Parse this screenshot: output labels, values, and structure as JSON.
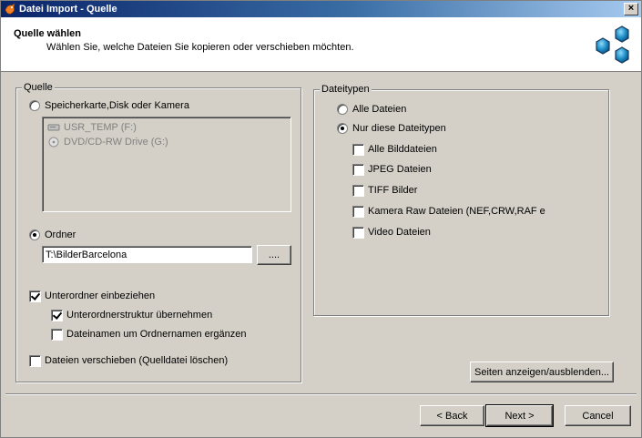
{
  "window": {
    "title": "Datei Import - Quelle",
    "close_label": "×"
  },
  "header": {
    "title": "Quelle wählen",
    "subtitle": "Wählen Sie, welche Dateien Sie kopieren oder verschieben möchten."
  },
  "source": {
    "legend": "Quelle",
    "device_radio_label": "Speicherkarte,Disk oder Kamera",
    "drives": [
      {
        "label": "USR_TEMP (F:)",
        "icon": "removable-drive-icon"
      },
      {
        "label": "DVD/CD-RW Drive (G:)",
        "icon": "dvd-drive-icon"
      }
    ],
    "folder_radio_label": "Ordner",
    "folder_path": "T:\\BilderBarcelona",
    "browse_label": "....",
    "include_subfolders_label": "Unterordner einbeziehen",
    "keep_structure_label": "Unterordnerstruktur übernehmen",
    "append_folder_name_label": "Dateinamen um Ordnernamen ergänzen",
    "move_files_label": "Dateien verschieben (Quelldatei löschen)"
  },
  "filetypes": {
    "legend": "Dateitypen",
    "all_files_label": "Alle Dateien",
    "only_these_label": "Nur diese Dateitypen",
    "types": [
      {
        "label": "Alle Bilddateien",
        "checked": false
      },
      {
        "label": "JPEG Dateien",
        "checked": false
      },
      {
        "label": "TIFF Bilder",
        "checked": false
      },
      {
        "label": "Kamera Raw Dateien (NEF,CRW,RAF e",
        "checked": false
      },
      {
        "label": "Video Dateien",
        "checked": false
      }
    ]
  },
  "toggle_pages_label": "Seiten anzeigen/ausblenden...",
  "footer": {
    "back_label": "< Back",
    "next_label": "Next >",
    "cancel_label": "Cancel"
  },
  "colors": {
    "titlebar_start": "#0a246a",
    "titlebar_end": "#a6caf0",
    "face": "#d4d0c8",
    "logo": "#1e90c8"
  }
}
